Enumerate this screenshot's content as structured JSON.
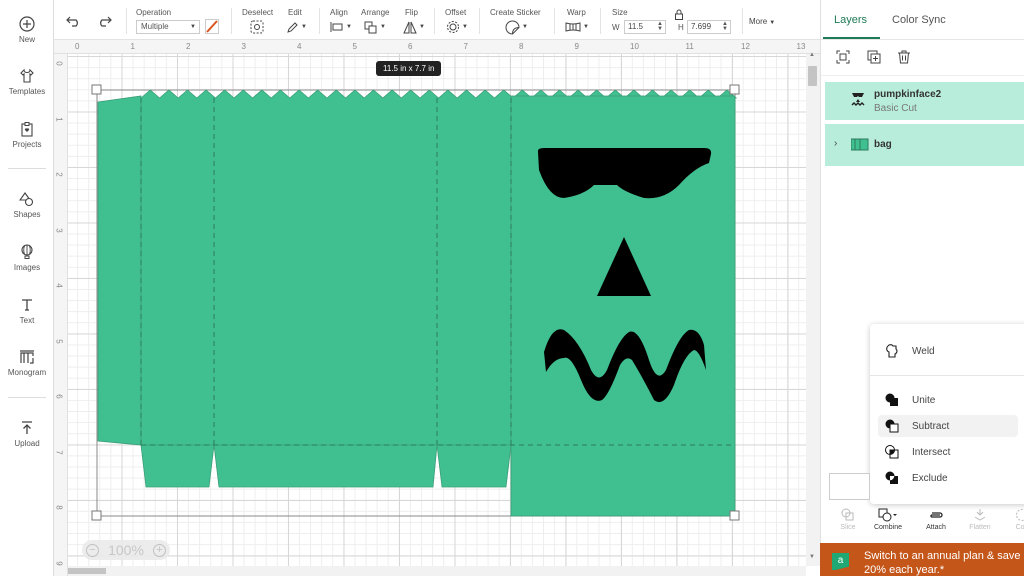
{
  "sidebar": {
    "items": [
      {
        "label": "New",
        "icon": "plus-circle-icon"
      },
      {
        "label": "Templates",
        "icon": "shirt-icon"
      },
      {
        "label": "Projects",
        "icon": "clipboard-heart-icon"
      },
      {
        "label": "Shapes",
        "icon": "shapes-icon"
      },
      {
        "label": "Images",
        "icon": "balloon-icon"
      },
      {
        "label": "Text",
        "icon": "text-t-icon"
      },
      {
        "label": "Monogram",
        "icon": "monogram-icon"
      },
      {
        "label": "Upload",
        "icon": "upload-icon"
      }
    ]
  },
  "toolbar": {
    "undo": "undo-icon",
    "redo": "redo-icon",
    "operation_label": "Operation",
    "operation_value": "Multiple",
    "deselect_label": "Deselect",
    "edit_label": "Edit",
    "align_label": "Align",
    "arrange_label": "Arrange",
    "flip_label": "Flip",
    "offset_label": "Offset",
    "sticker_label": "Create Sticker",
    "warp_label": "Warp",
    "size_label": "Size",
    "w_label": "W",
    "w_value": "11.5",
    "h_label": "H",
    "h_value": "7.699",
    "more_label": "More"
  },
  "canvas": {
    "ruler_top": [
      "0",
      "1",
      "2",
      "3",
      "4",
      "5",
      "6",
      "7",
      "8",
      "9",
      "10",
      "11",
      "12",
      "13"
    ],
    "ruler_left": [
      "0",
      "1",
      "2",
      "3",
      "4",
      "5",
      "6",
      "7",
      "8",
      "9"
    ],
    "size_tooltip": "11.5  in x 7.7  in",
    "zoom_level": "100%",
    "accent_color": "#40c090"
  },
  "panel": {
    "tabs": [
      {
        "label": "Layers",
        "active": true
      },
      {
        "label": "Color Sync",
        "active": false
      }
    ],
    "layers": [
      {
        "name": "pumpkinface2",
        "sub": "Basic Cut"
      },
      {
        "name": "bag",
        "sub": ""
      }
    ],
    "context_menu": [
      "Weld",
      "Unite",
      "Subtract",
      "Intersect",
      "Exclude"
    ],
    "bottom_tools": [
      {
        "label": "Slice",
        "enabled": false
      },
      {
        "label": "Combine",
        "enabled": true
      },
      {
        "label": "Attach",
        "enabled": true
      },
      {
        "label": "Flatten",
        "enabled": false
      },
      {
        "label": "Con",
        "enabled": false
      }
    ],
    "promo_line1": "Switch to an annual plan & save",
    "promo_line2": "20% each year.*",
    "promo_icon_letter": "a"
  }
}
